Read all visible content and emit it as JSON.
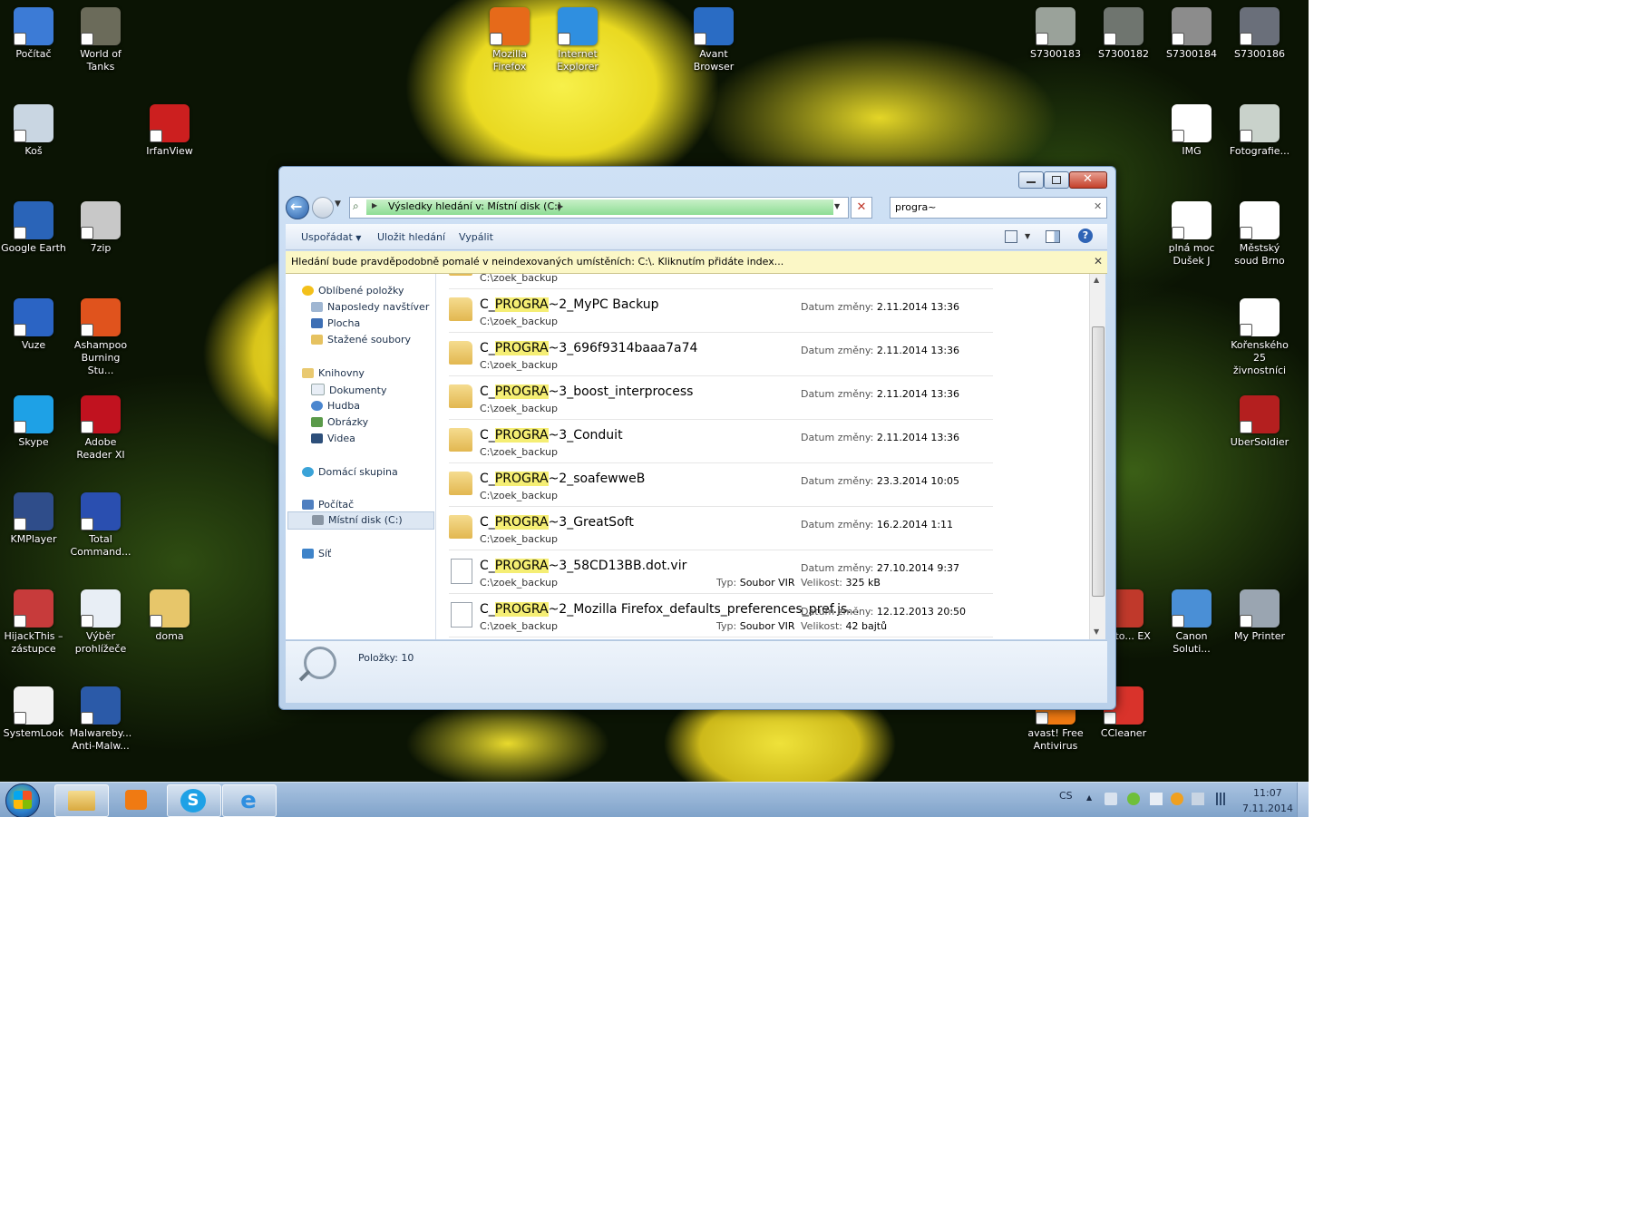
{
  "desktop": {
    "icons": [
      {
        "label": "Počítač",
        "color": "#3c7bd6"
      },
      {
        "label": "World of Tanks",
        "color": "#6b6b5a"
      },
      {
        "label": "Koš",
        "color": "#c9d6e2"
      },
      {
        "label": "IrfanView",
        "color": "#cc1f1f"
      },
      {
        "label": "Google Earth",
        "color": "#2a64b8"
      },
      {
        "label": "7zip",
        "color": "#c8c8c8"
      },
      {
        "label": "Vuze",
        "color": "#2b64c4"
      },
      {
        "label": "Ashampoo Burning Stu...",
        "color": "#e0531d"
      },
      {
        "label": "Skype",
        "color": "#1ea1e6"
      },
      {
        "label": "Adobe Reader XI",
        "color": "#c1121f"
      },
      {
        "label": "KMPlayer",
        "color": "#2f4d8a"
      },
      {
        "label": "Total Command...",
        "color": "#2a4fb0"
      },
      {
        "label": "HijackThis – zástupce",
        "color": "#c73b3b"
      },
      {
        "label": "Výběr prohlížeče",
        "color": "#e8eef5"
      },
      {
        "label": "doma",
        "color": "#e7c66a"
      },
      {
        "label": "SystemLook",
        "color": "#f2f2f2"
      },
      {
        "label": "Malwareby... Anti-Malw...",
        "color": "#2b5aa8"
      },
      {
        "label": "Mozilla Firefox",
        "color": "#e66a1a"
      },
      {
        "label": "Internet Explorer",
        "color": "#2f8fe0"
      },
      {
        "label": "Avant Browser",
        "color": "#2a6cc4"
      },
      {
        "label": "S7300183",
        "color": "#9aa29a"
      },
      {
        "label": "S7300182",
        "color": "#6f756f"
      },
      {
        "label": "S7300184",
        "color": "#8c8c8c"
      },
      {
        "label": "S7300186",
        "color": "#6a6f7a"
      },
      {
        "label": "IMG",
        "color": "#ffffff"
      },
      {
        "label": "Fotografie...",
        "color": "#c9d2cb"
      },
      {
        "label": "plná moc Dušek J",
        "color": "#ffffff"
      },
      {
        "label": "Městský soud Brno",
        "color": "#ffffff"
      },
      {
        "label": "Kořenského 25 živnostníci",
        "color": "#ffffff"
      },
      {
        "label": "UberSoldier",
        "color": "#b41f1f"
      },
      {
        "label": "Photo... EX",
        "color": "#c0392b"
      },
      {
        "label": "Canon Soluti...",
        "color": "#4a8fd6"
      },
      {
        "label": "My Printer",
        "color": "#9aa5b1"
      },
      {
        "label": "avast! Free Antivirus",
        "color": "#f07a12"
      },
      {
        "label": "CCleaner",
        "color": "#d9332b"
      }
    ]
  },
  "window": {
    "address": "Výsledky hledání v: Místní disk (C:)",
    "search_value": "progra~",
    "toolbar": {
      "organize": "Uspořádat",
      "save_search": "Uložit hledání",
      "burn": "Vypálit"
    },
    "infobar": "Hledání bude pravděpodobně pomalé v neindexovaných umístěních: C:\\. Kliknutím přidáte index...",
    "nav": {
      "favorites": "Oblíbené položky",
      "recent": "Naposledy navštíver",
      "desktop": "Plocha",
      "downloads": "Stažené soubory",
      "libraries": "Knihovny",
      "documents": "Dokumenty",
      "music": "Hudba",
      "pictures": "Obrázky",
      "videos": "Videa",
      "homegroup": "Domácí skupina",
      "computer": "Počítač",
      "local_disk": "Místní disk (C:)",
      "network": "Síť"
    },
    "labels": {
      "date": "Datum změny:",
      "type": "Typ:",
      "size": "Velikost:"
    },
    "top_partial_path": "C:\\zoek_backup",
    "results": [
      {
        "prefix": "C_",
        "match": "PROGRA",
        "suffix": "~2_MyPC Backup",
        "path": "C:\\zoek_backup",
        "date": "2.11.2014 13:36",
        "kind": "folder"
      },
      {
        "prefix": "C_",
        "match": "PROGRA",
        "suffix": "~3_696f9314baaa7a74",
        "path": "C:\\zoek_backup",
        "date": "2.11.2014 13:36",
        "kind": "folder"
      },
      {
        "prefix": "C_",
        "match": "PROGRA",
        "suffix": "~3_boost_interprocess",
        "path": "C:\\zoek_backup",
        "date": "2.11.2014 13:36",
        "kind": "folder"
      },
      {
        "prefix": "C_",
        "match": "PROGRA",
        "suffix": "~3_Conduit",
        "path": "C:\\zoek_backup",
        "date": "2.11.2014 13:36",
        "kind": "folder"
      },
      {
        "prefix": "C_",
        "match": "PROGRA",
        "suffix": "~2_soafewweB",
        "path": "C:\\zoek_backup",
        "date": "23.3.2014 10:05",
        "kind": "folder"
      },
      {
        "prefix": "C_",
        "match": "PROGRA",
        "suffix": "~3_GreatSoft",
        "path": "C:\\zoek_backup",
        "date": "16.2.2014 1:11",
        "kind": "folder"
      },
      {
        "prefix": "C_",
        "match": "PROGRA",
        "suffix": "~3_58CD13BB.dot.vir",
        "path": "C:\\zoek_backup",
        "date": "27.10.2014 9:37",
        "type": "Soubor VIR",
        "size": "325 kB",
        "kind": "file"
      },
      {
        "prefix": "C_",
        "match": "PROGRA",
        "suffix": "~2_Mozilla Firefox_defaults_preferences_pref.js...",
        "path": "C:\\zoek_backup",
        "date": "12.12.2013 20:50",
        "type": "Soubor VIR",
        "size": "42 bajtů",
        "kind": "file"
      }
    ],
    "status": "Položky: 10"
  },
  "taskbar": {
    "lang": "CS",
    "time": "11:07",
    "date": "7.11.2014"
  }
}
